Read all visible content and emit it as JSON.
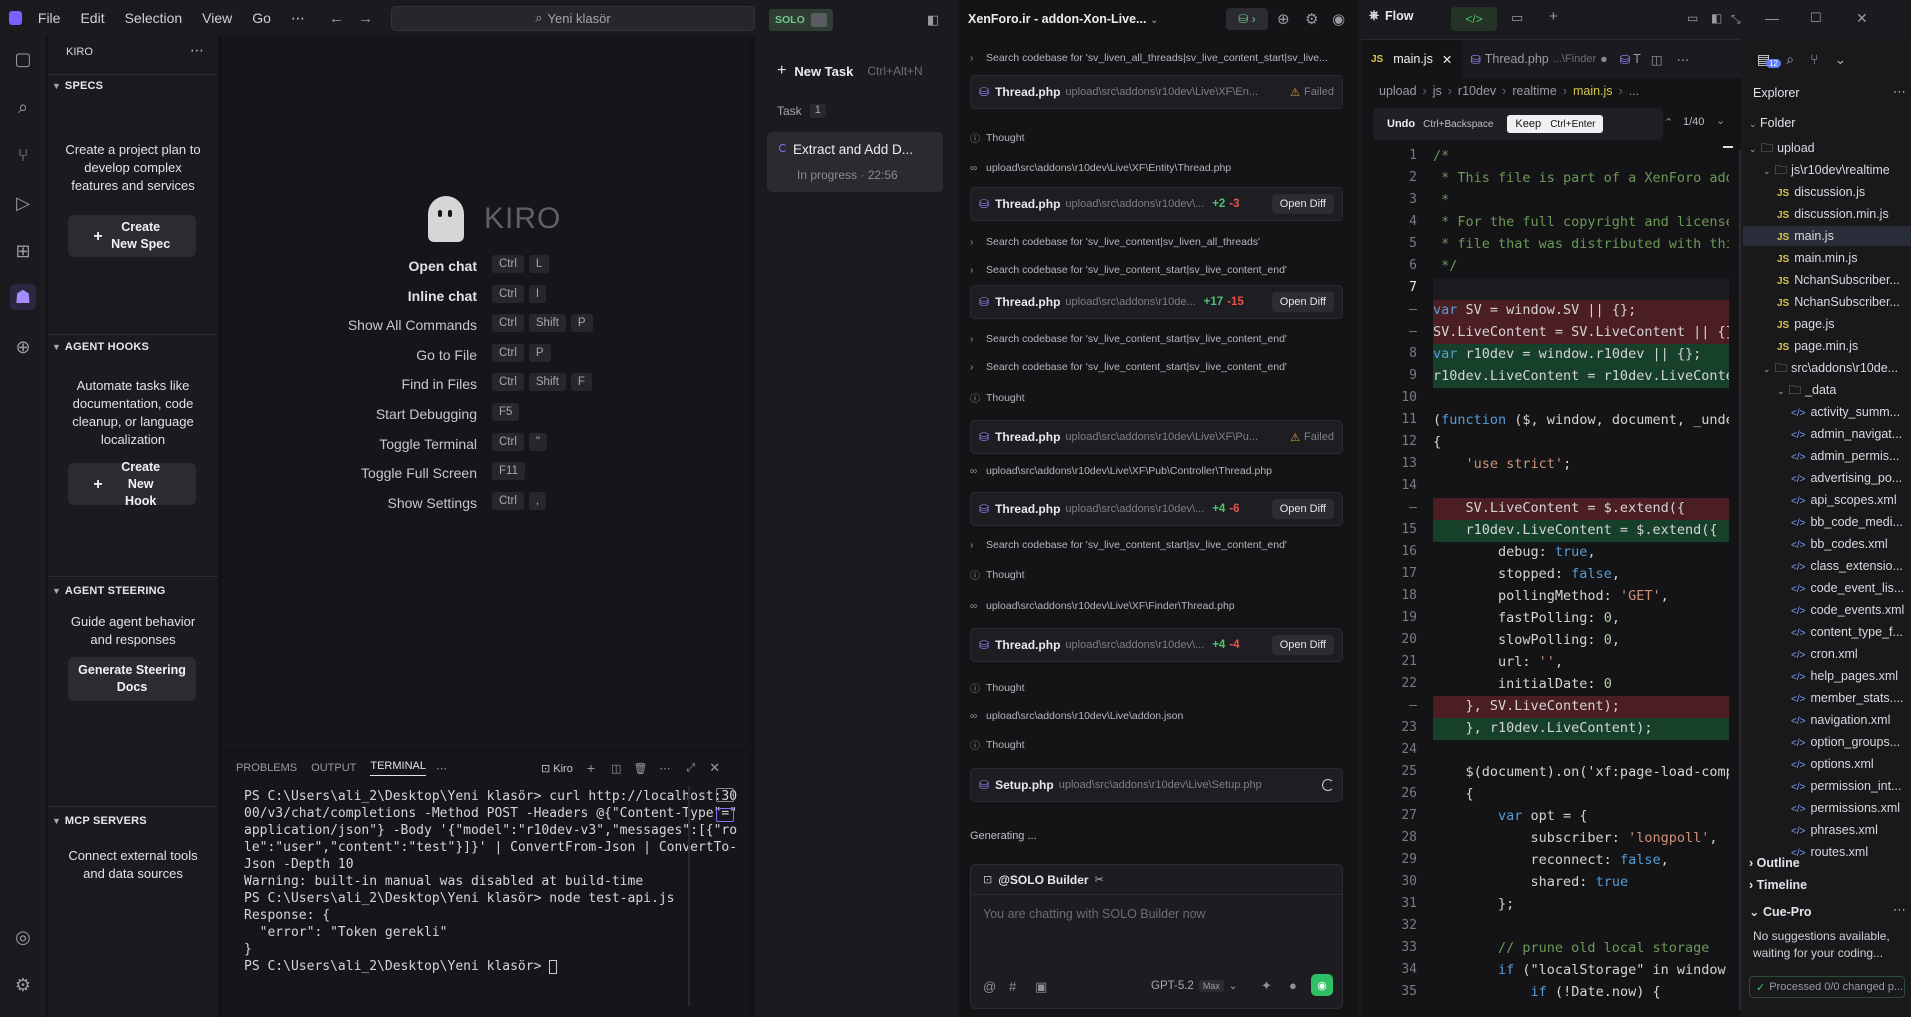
{
  "kiro": {
    "menu": [
      "File",
      "Edit",
      "Selection",
      "View",
      "Go"
    ],
    "search_placeholder": "Yeni klasör",
    "sidebar_title": "KIRO",
    "specs": {
      "title": "SPECS",
      "desc": "Create a project plan to develop complex features and services",
      "button": "Create New Spec"
    },
    "hooks": {
      "title": "AGENT HOOKS",
      "desc": "Automate tasks like documentation, code cleanup, or language localization",
      "button": "Create New Hook"
    },
    "steering": {
      "title": "AGENT STEERING",
      "desc": "Guide agent behavior and responses",
      "button": "Generate Steering Docs"
    },
    "mcp": {
      "title": "MCP SERVERS",
      "desc": "Connect external tools and data sources"
    },
    "logo_text": "KIRO",
    "shortcuts": [
      {
        "label": "Open chat",
        "keys": [
          "Ctrl",
          "L"
        ],
        "bold": true
      },
      {
        "label": "Inline chat",
        "keys": [
          "Ctrl",
          "I"
        ],
        "bold": true
      },
      {
        "label": "Show All Commands",
        "keys": [
          "Ctrl",
          "Shift",
          "P"
        ]
      },
      {
        "label": "Go to File",
        "keys": [
          "Ctrl",
          "P"
        ]
      },
      {
        "label": "Find in Files",
        "keys": [
          "Ctrl",
          "Shift",
          "F"
        ]
      },
      {
        "label": "Start Debugging",
        "keys": [
          "F5"
        ]
      },
      {
        "label": "Toggle Terminal",
        "keys": [
          "Ctrl",
          "\""
        ]
      },
      {
        "label": "Toggle Full Screen",
        "keys": [
          "F11"
        ]
      },
      {
        "label": "Show Settings",
        "keys": [
          "Ctrl",
          ","
        ]
      }
    ],
    "panel_tabs": [
      "PROBLEMS",
      "OUTPUT",
      "TERMINAL"
    ],
    "terminal_profile": "Kiro",
    "terminal_lines": [
      "PS C:\\Users\\ali_2\\Desktop\\Yeni klasör> curl http://localhost:30",
      "00/v3/chat/completions -Method POST -Headers @{\"Content-Type\"=\"",
      "application/json\"} -Body '{\"model\":\"r10dev-v3\",\"messages\":[{\"ro",
      "le\":\"user\",\"content\":\"test\"}]}' | ConvertFrom-Json | ConvertTo-",
      "Json -Depth 10",
      "Warning: built-in manual was disabled at build-time",
      "PS C:\\Users\\ali_2\\Desktop\\Yeni klasör> node test-api.js",
      "Response: {",
      "  \"error\": \"Token gerekli\"",
      "}",
      "PS C:\\Users\\ali_2\\Desktop\\Yeni klasör> "
    ]
  },
  "solo": {
    "badge": "SOLO",
    "new_task": "New Task",
    "new_task_shortcut": "Ctrl+Alt+N",
    "task_label": "Task",
    "task_count": "1",
    "task_title": "Extract and Add D...",
    "task_status": "In progress · 22:56"
  },
  "chat": {
    "title": "XenForo.ir - addon-Xon-Live...",
    "items": [
      {
        "t": "row",
        "icon": "›",
        "text": "Search codebase for 'sv_liven_all_threads|sv_live_content_start|sv_live..."
      },
      {
        "t": "card",
        "file": "Thread.php",
        "path": "upload\\src\\addons\\r10dev\\Live\\XF\\En...",
        "status": "Failed"
      },
      {
        "t": "row",
        "icon": "ⓘ",
        "text": "Thought"
      },
      {
        "t": "row",
        "icon": "∞",
        "text": "upload\\src\\addons\\r10dev\\Live\\XF\\Entity\\Thread.php"
      },
      {
        "t": "card",
        "file": "Thread.php",
        "path": "upload\\src\\addons\\r10dev\\...",
        "add": "+2",
        "del": "-3",
        "button": "Open Diff"
      },
      {
        "t": "row",
        "icon": "›",
        "text": "Search codebase for 'sv_live_content|sv_liven_all_threads'"
      },
      {
        "t": "row",
        "icon": "›",
        "text": "Search codebase for 'sv_live_content_start|sv_live_content_end'"
      },
      {
        "t": "card",
        "file": "Thread.php",
        "path": "upload\\src\\addons\\r10de...",
        "add": "+17",
        "del": "-15",
        "button": "Open Diff"
      },
      {
        "t": "row",
        "icon": "›",
        "text": "Search codebase for 'sv_live_content_start|sv_live_content_end'"
      },
      {
        "t": "row",
        "icon": "›",
        "text": "Search codebase for 'sv_live_content_start|sv_live_content_end'"
      },
      {
        "t": "row",
        "icon": "ⓘ",
        "text": "Thought"
      },
      {
        "t": "card",
        "file": "Thread.php",
        "path": "upload\\src\\addons\\r10dev\\Live\\XF\\Pu...",
        "status": "Failed"
      },
      {
        "t": "row",
        "icon": "∞",
        "text": "upload\\src\\addons\\r10dev\\Live\\XF\\Pub\\Controller\\Thread.php"
      },
      {
        "t": "card",
        "file": "Thread.php",
        "path": "upload\\src\\addons\\r10dev\\...",
        "add": "+4",
        "del": "-6",
        "button": "Open Diff"
      },
      {
        "t": "row",
        "icon": "›",
        "text": "Search codebase for 'sv_live_content_start|sv_live_content_end'"
      },
      {
        "t": "row",
        "icon": "ⓘ",
        "text": "Thought"
      },
      {
        "t": "row",
        "icon": "∞",
        "text": "upload\\src\\addons\\r10dev\\Live\\XF\\Finder\\Thread.php"
      },
      {
        "t": "card",
        "file": "Thread.php",
        "path": "upload\\src\\addons\\r10dev\\...",
        "add": "+4",
        "del": "-4",
        "button": "Open Diff"
      },
      {
        "t": "row",
        "icon": "ⓘ",
        "text": "Thought"
      },
      {
        "t": "row",
        "icon": "∞",
        "text": "upload\\src\\addons\\r10dev\\Live\\addon.json"
      },
      {
        "t": "row",
        "icon": "ⓘ",
        "text": "Thought"
      },
      {
        "t": "card",
        "file": "Setup.php",
        "path": "upload\\src\\addons\\r10dev\\Live\\Setup.php",
        "spinner": true
      }
    ],
    "generating": "Generating ...",
    "builder": "@SOLO Builder",
    "input_placeholder": "You are chatting with SOLO Builder now",
    "model": "GPT-5.2",
    "model_badge": "Max"
  },
  "code": {
    "flow_tab": "Flow",
    "tab_main": "main.js",
    "tab_thread": "Thread.php",
    "tab_thread_path": "...\\Finder",
    "tab_extra": "T",
    "breadcrumb": [
      "upload",
      "js",
      "r10dev",
      "realtime",
      "main.js",
      "..."
    ],
    "undo": "Undo",
    "undo_key": "Ctrl+Backspace",
    "keep": "Keep",
    "keep_key": "Ctrl+Enter",
    "counter": "1/40",
    "lines": [
      {
        "n": "1",
        "c": "/*",
        "k": "cm"
      },
      {
        "n": "2",
        "c": " * This file is part of a XenForo add-",
        "k": "cm"
      },
      {
        "n": "3",
        "c": " *",
        "k": "cm"
      },
      {
        "n": "4",
        "c": " * For the full copyright and license",
        "k": "cm"
      },
      {
        "n": "5",
        "c": " * file that was distributed with this",
        "k": "cm"
      },
      {
        "n": "6",
        "c": " */",
        "k": "cm"
      },
      {
        "n": "7",
        "c": "",
        "k": "cur"
      },
      {
        "n": "",
        "c": "var SV = window.SV || {};",
        "k": "del"
      },
      {
        "n": "",
        "c": "SV.LiveContent = SV.LiveContent || {};",
        "k": "del"
      },
      {
        "n": "8",
        "c": "var r10dev = window.r10dev || {};",
        "k": "add"
      },
      {
        "n": "9",
        "c": "r10dev.LiveContent = r10dev.LiveConten",
        "k": "add"
      },
      {
        "n": "10",
        "c": "",
        "k": ""
      },
      {
        "n": "11",
        "c": "(function ($, window, document, _undef",
        "k": ""
      },
      {
        "n": "12",
        "c": "{",
        "k": ""
      },
      {
        "n": "13",
        "c": "    'use strict';",
        "k": ""
      },
      {
        "n": "14",
        "c": "",
        "k": ""
      },
      {
        "n": "",
        "c": "    SV.LiveContent = $.extend({",
        "k": "del"
      },
      {
        "n": "15",
        "c": "    r10dev.LiveContent = $.extend({",
        "k": "add"
      },
      {
        "n": "16",
        "c": "        debug: true,",
        "k": ""
      },
      {
        "n": "17",
        "c": "        stopped: false,",
        "k": ""
      },
      {
        "n": "18",
        "c": "        pollingMethod: 'GET',",
        "k": ""
      },
      {
        "n": "19",
        "c": "        fastPolling: 0,",
        "k": ""
      },
      {
        "n": "20",
        "c": "        slowPolling: 0,",
        "k": ""
      },
      {
        "n": "21",
        "c": "        url: '',",
        "k": ""
      },
      {
        "n": "22",
        "c": "        initialDate: 0",
        "k": ""
      },
      {
        "n": "",
        "c": "    }, SV.LiveContent);",
        "k": "del"
      },
      {
        "n": "23",
        "c": "    }, r10dev.LiveContent);",
        "k": "add"
      },
      {
        "n": "24",
        "c": "",
        "k": ""
      },
      {
        "n": "25",
        "c": "    $(document).on('xf:page-load-compl",
        "k": ""
      },
      {
        "n": "26",
        "c": "    {",
        "k": ""
      },
      {
        "n": "27",
        "c": "        var opt = {",
        "k": ""
      },
      {
        "n": "28",
        "c": "            subscriber: 'longpoll',",
        "k": ""
      },
      {
        "n": "29",
        "c": "            reconnect: false,",
        "k": ""
      },
      {
        "n": "30",
        "c": "            shared: true",
        "k": ""
      },
      {
        "n": "31",
        "c": "        };",
        "k": ""
      },
      {
        "n": "32",
        "c": "",
        "k": ""
      },
      {
        "n": "33",
        "c": "        // prune old local storage",
        "k": "cm"
      },
      {
        "n": "34",
        "c": "        if (\"localStorage\" in window &",
        "k": ""
      },
      {
        "n": "35",
        "c": "            if (!Date.now) {",
        "k": ""
      }
    ]
  },
  "explorer": {
    "title": "Explorer",
    "folder": "Folder",
    "badge": "12",
    "tree": [
      {
        "d": 0,
        "name": "upload",
        "type": "folder"
      },
      {
        "d": 1,
        "name": "js\\r10dev\\realtime",
        "type": "folder"
      },
      {
        "d": 2,
        "name": "discussion.js",
        "type": "js"
      },
      {
        "d": 2,
        "name": "discussion.min.js",
        "type": "js"
      },
      {
        "d": 2,
        "name": "main.js",
        "type": "js",
        "sel": true
      },
      {
        "d": 2,
        "name": "main.min.js",
        "type": "js"
      },
      {
        "d": 2,
        "name": "NchanSubscriber...",
        "type": "js"
      },
      {
        "d": 2,
        "name": "NchanSubscriber...",
        "type": "js"
      },
      {
        "d": 2,
        "name": "page.js",
        "type": "js"
      },
      {
        "d": 2,
        "name": "page.min.js",
        "type": "js"
      },
      {
        "d": 1,
        "name": "src\\addons\\r10de...",
        "type": "folder"
      },
      {
        "d": 2,
        "name": "_data",
        "type": "folder"
      },
      {
        "d": 3,
        "name": "activity_summ...",
        "type": "xml"
      },
      {
        "d": 3,
        "name": "admin_navigat...",
        "type": "xml"
      },
      {
        "d": 3,
        "name": "admin_permis...",
        "type": "xml"
      },
      {
        "d": 3,
        "name": "advertising_po...",
        "type": "xml"
      },
      {
        "d": 3,
        "name": "api_scopes.xml",
        "type": "xml"
      },
      {
        "d": 3,
        "name": "bb_code_medi...",
        "type": "xml"
      },
      {
        "d": 3,
        "name": "bb_codes.xml",
        "type": "xml"
      },
      {
        "d": 3,
        "name": "class_extensio...",
        "type": "xml"
      },
      {
        "d": 3,
        "name": "code_event_lis...",
        "type": "xml"
      },
      {
        "d": 3,
        "name": "code_events.xml",
        "type": "xml"
      },
      {
        "d": 3,
        "name": "content_type_f...",
        "type": "xml"
      },
      {
        "d": 3,
        "name": "cron.xml",
        "type": "xml"
      },
      {
        "d": 3,
        "name": "help_pages.xml",
        "type": "xml"
      },
      {
        "d": 3,
        "name": "member_stats....",
        "type": "xml"
      },
      {
        "d": 3,
        "name": "navigation.xml",
        "type": "xml"
      },
      {
        "d": 3,
        "name": "option_groups...",
        "type": "xml"
      },
      {
        "d": 3,
        "name": "options.xml",
        "type": "xml"
      },
      {
        "d": 3,
        "name": "permission_int...",
        "type": "xml"
      },
      {
        "d": 3,
        "name": "permissions.xml",
        "type": "xml"
      },
      {
        "d": 3,
        "name": "phrases.xml",
        "type": "xml"
      },
      {
        "d": 3,
        "name": "routes.xml",
        "type": "xml"
      }
    ],
    "outline": "Outline",
    "timeline": "Timeline",
    "cuepro": "Cue-Pro",
    "cue_msg": "No suggestions available, waiting for your coding...",
    "processed": "Processed 0/0 changed p..."
  }
}
